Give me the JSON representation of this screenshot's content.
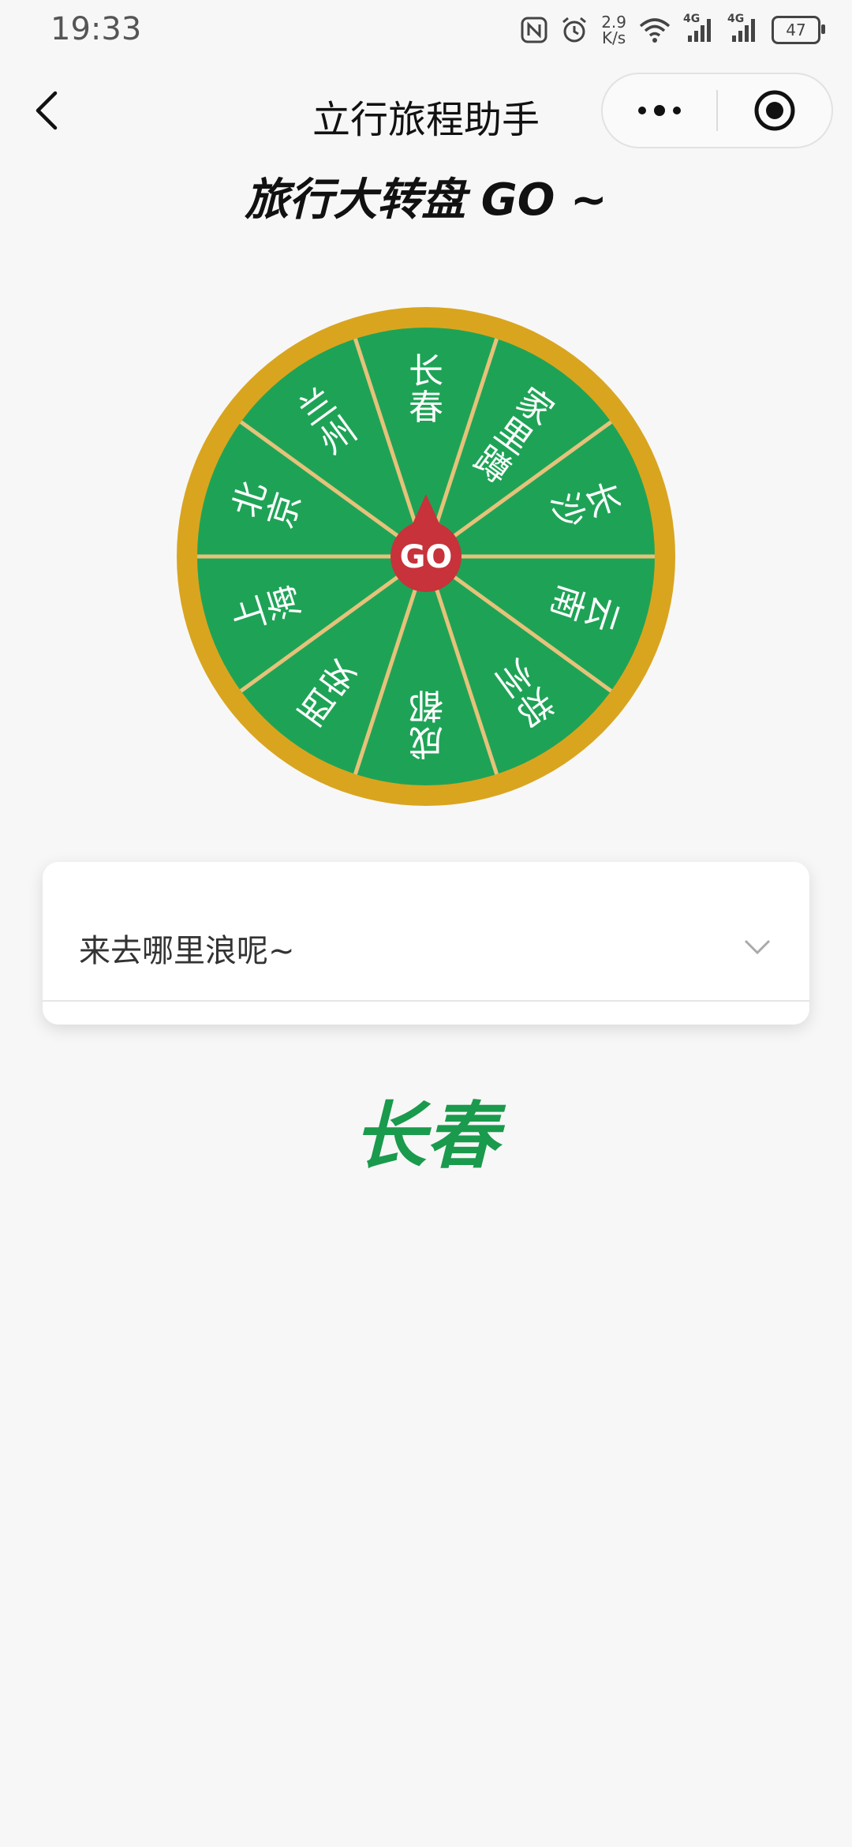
{
  "status_bar": {
    "time": "19:33",
    "net_speed_value": "2.9",
    "net_speed_unit": "K/s",
    "signal_1_label": "4G",
    "signal_2_label": "4G",
    "battery": "47"
  },
  "nav": {
    "title": "立行旅程助手"
  },
  "heading": "旅行大转盘 GO ~",
  "wheel": {
    "center_label": "GO",
    "colors": {
      "rim": "#d9a51f",
      "segment": "#1ea356",
      "divider": "#e6c27a",
      "pointer": "#c7323b",
      "text": "#ffffff"
    },
    "segments": [
      "长春",
      "家里蹲",
      "长沙",
      "云南",
      "郑州",
      "成都",
      "西安",
      "上海",
      "北京",
      "兰州"
    ]
  },
  "dropdown": {
    "label": "来去哪里浪呢~"
  },
  "result": "长春"
}
